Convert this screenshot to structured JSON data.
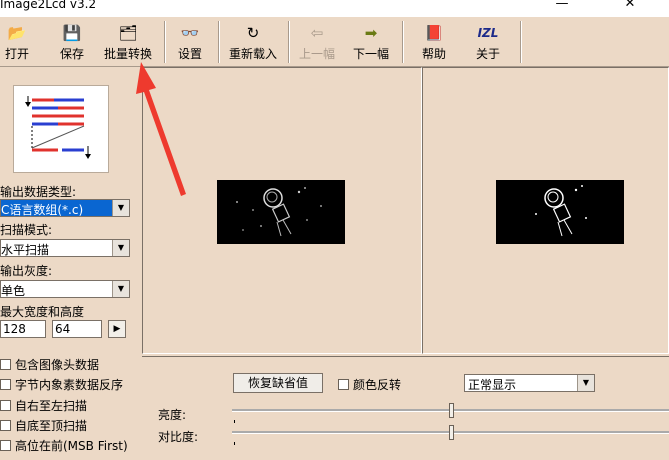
{
  "window": {
    "title": "Image2Lcd v3.2",
    "minimize_glyph": "—",
    "close_glyph": "✕"
  },
  "toolbar": {
    "buttons": [
      {
        "label": "打开",
        "icon": "folder-open-icon",
        "glyph": "📂"
      },
      {
        "label": "保存",
        "icon": "floppy-disk-icon",
        "glyph": "💾"
      },
      {
        "label": "批量转换",
        "icon": "batch-convert-icon",
        "glyph": "🗂"
      },
      {
        "label": "设置",
        "icon": "glasses-icon",
        "glyph": "👓"
      },
      {
        "label": "重新载入",
        "icon": "reload-icon",
        "glyph": "↻"
      },
      {
        "label": "上一幅",
        "icon": "arrow-left-icon",
        "glyph": "⇦"
      },
      {
        "label": "下一幅",
        "icon": "arrow-right-icon",
        "glyph": "➡"
      },
      {
        "label": "帮助",
        "icon": "help-book-icon",
        "glyph": "📕"
      },
      {
        "label": "关于",
        "icon": "about-logo-icon",
        "glyph": "IZL"
      }
    ]
  },
  "left": {
    "output_type_label": "输出数据类型:",
    "output_type_value": "C语言数组(*.c)",
    "scan_mode_label": "扫描模式:",
    "scan_mode_value": "水平扫描",
    "gray_label": "输出灰度:",
    "gray_value": "单色",
    "max_size_label": "最大宽度和高度",
    "max_width": "128",
    "max_height": "64",
    "spin_glyph": "▶",
    "combo_arrow": "▼",
    "checkboxes": [
      "包含图像头数据",
      "字节内象素数据反序",
      "自右至左扫描",
      "自底至顶扫描",
      "高位在前(MSB First)"
    ]
  },
  "bottom": {
    "restore_defaults": "恢复缺省值",
    "invert_color": "颜色反转",
    "display_mode": "正常显示",
    "brightness_label": "亮度:",
    "contrast_label": "对比度:",
    "brightness_level": 0.5,
    "contrast_level": 0.5
  },
  "colors": {
    "background": "#ecd9c6",
    "selection": "#0a66d1",
    "annotation_arrow": "#ee3a2e"
  }
}
